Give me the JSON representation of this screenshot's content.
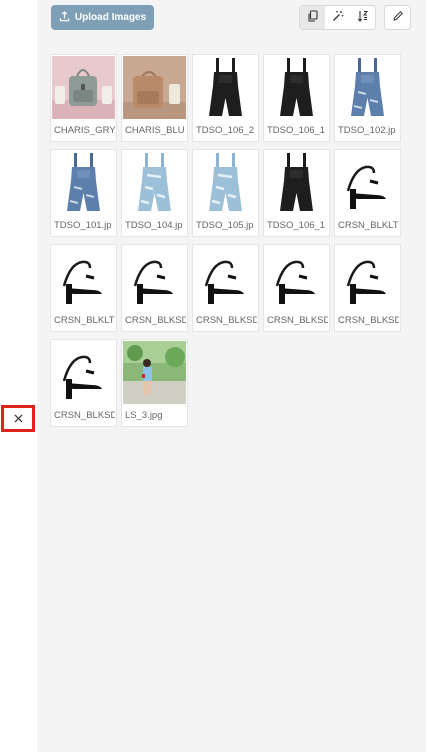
{
  "toolbar": {
    "upload_label": "Upload Images",
    "tools": [
      {
        "icon": "copy-icon",
        "active": true
      },
      {
        "icon": "magic-wand-icon",
        "active": false
      },
      {
        "icon": "sort-icon",
        "active": false
      }
    ],
    "edit_icon": "pencil-icon"
  },
  "images": [
    {
      "name": "CHARIS_GRY",
      "kind": "bag-grey"
    },
    {
      "name": "CHARIS_BLU",
      "kind": "bag-tan"
    },
    {
      "name": "TDSO_106_2",
      "kind": "overall-black"
    },
    {
      "name": "TDSO_106_1",
      "kind": "overall-black"
    },
    {
      "name": "TDSO_102.jp",
      "kind": "overall-denim"
    },
    {
      "name": "TDSO_101.jp",
      "kind": "overall-denim"
    },
    {
      "name": "TDSO_104.jp",
      "kind": "overall-light"
    },
    {
      "name": "TDSO_105.jp",
      "kind": "overall-light"
    },
    {
      "name": "TDSO_106_1",
      "kind": "overall-black"
    },
    {
      "name": "CRSN_BLKLT",
      "kind": "heel"
    },
    {
      "name": "CRSN_BLKLT",
      "kind": "heel"
    },
    {
      "name": "CRSN_BLKSD",
      "kind": "heel"
    },
    {
      "name": "CRSN_BLKSD",
      "kind": "heel"
    },
    {
      "name": "CRSN_BLKSD",
      "kind": "heel"
    },
    {
      "name": "CRSN_BLKSD",
      "kind": "heel"
    },
    {
      "name": "CRSN_BLKSD",
      "kind": "heel"
    },
    {
      "name": "LS_3.jpg",
      "kind": "photo"
    }
  ],
  "close_icon": "close-icon"
}
